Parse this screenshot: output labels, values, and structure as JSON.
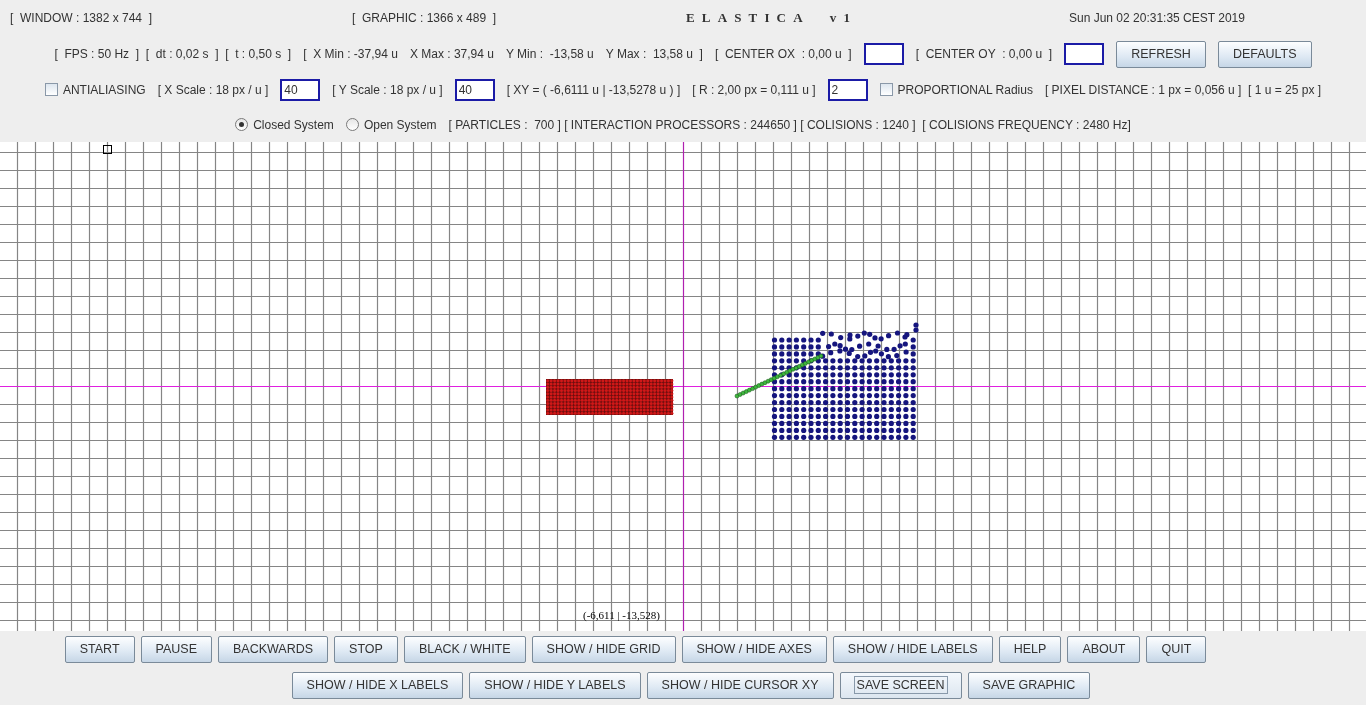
{
  "header": {
    "window_size": "[  WINDOW : 1382 x 744  ]",
    "graphic_size": "[  GRAPHIC : 1366 x 489  ]",
    "app_title": "ELASTICA  v1",
    "datetime": "Sun Jun 02 20:31:35 CEST 2019"
  },
  "controls": [
    [
      {
        "kind": "text",
        "text": "[  FPS : 50 Hz  ]  [  dt : 0,02 s  ]  [  t : 0,50 s  ]"
      },
      {
        "kind": "text",
        "text": "[  X Min : -37,94 u"
      },
      {
        "kind": "text",
        "text": "X Max : 37,94 u"
      },
      {
        "kind": "text",
        "text": "Y Min :  -13,58 u"
      },
      {
        "kind": "text",
        "text": "Y Max :  13,58 u  ]"
      },
      {
        "kind": "text",
        "text": "[  CENTER OX  : 0,00 u  ]"
      },
      {
        "kind": "field"
      },
      {
        "kind": "text",
        "text": "[  CENTER OY  : 0,00 u  ]"
      },
      {
        "kind": "field"
      },
      {
        "kind": "button",
        "label": "REFRESH"
      },
      {
        "kind": "button",
        "label": "DEFAULTS"
      }
    ],
    [
      {
        "kind": "checkbox",
        "label": "ANTIALIASING",
        "checked": false
      },
      {
        "kind": "text",
        "text": "[ X Scale : 18 px / u ]"
      },
      {
        "kind": "field",
        "value": "40"
      },
      {
        "kind": "text",
        "text": "[ Y Scale : 18 px / u ]"
      },
      {
        "kind": "field",
        "value": "40"
      },
      {
        "kind": "text",
        "text": "[ XY = ( -6,6111 u | -13,5278 u ) ]"
      },
      {
        "kind": "text",
        "text": "[ R : 2,00 px = 0,111 u ]"
      },
      {
        "kind": "field",
        "value": "2"
      },
      {
        "kind": "checkbox",
        "label": "PROPORTIONAL Radius",
        "checked": false
      },
      {
        "kind": "text",
        "text": "[ PIXEL DISTANCE : 1 px = 0,056 u ]  [ 1 u = 25 px ]"
      }
    ],
    [
      {
        "kind": "radio",
        "label": "Closed System",
        "selected": true
      },
      {
        "kind": "radio",
        "label": "Open System",
        "selected": false
      },
      {
        "kind": "text",
        "text": "[ PARTICLES :  700 ] [ INTERACTION PROCESSORS : 244650 ] [ COLISIONS : 1240 ]  [ COLISIONS FREQUENCY : 2480 Hz]"
      }
    ]
  ],
  "canvas": {
    "cursor_label": "(-6,611 | -13,528)"
  },
  "button_rows": [
    [
      {
        "label": "START",
        "focused": false
      },
      {
        "label": "PAUSE",
        "focused": false
      },
      {
        "label": "BACKWARDS",
        "focused": false
      },
      {
        "label": "STOP",
        "focused": false
      },
      {
        "label": "BLACK / WHITE",
        "focused": false
      },
      {
        "label": "SHOW / HIDE GRID",
        "focused": false
      },
      {
        "label": "SHOW / HIDE AXES",
        "focused": false
      },
      {
        "label": "SHOW / HIDE LABELS",
        "focused": false
      },
      {
        "label": "HELP",
        "focused": false
      },
      {
        "label": "ABOUT",
        "focused": false
      },
      {
        "label": "QUIT",
        "focused": false
      }
    ],
    [
      {
        "label": "SHOW / HIDE X LABELS",
        "focused": false
      },
      {
        "label": "SHOW / HIDE Y LABELS",
        "focused": false
      },
      {
        "label": "SHOW / HIDE CURSOR XY",
        "focused": false
      },
      {
        "label": "SAVE SCREEN",
        "focused": true
      },
      {
        "label": "SAVE GRAPHIC",
        "focused": false
      }
    ]
  ]
}
